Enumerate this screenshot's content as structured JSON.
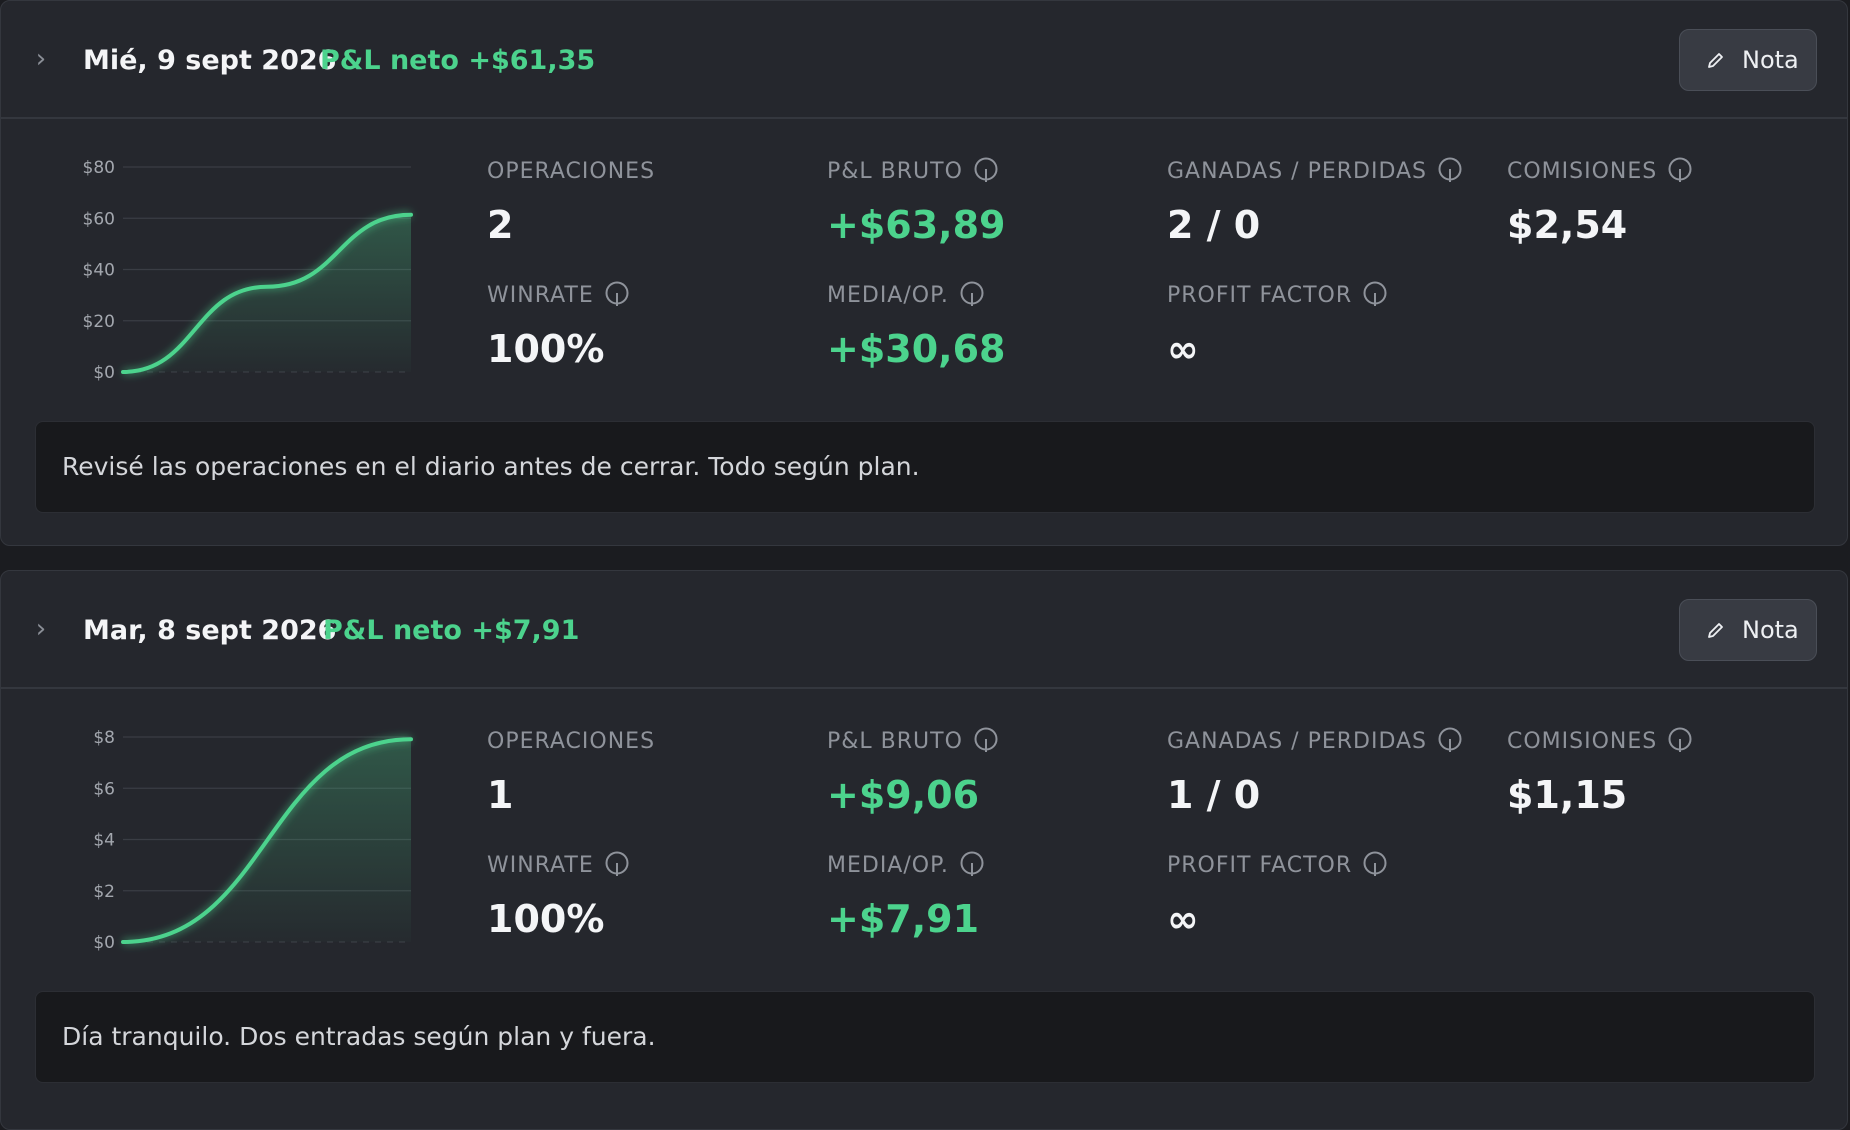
{
  "accent_color": "#4cd38d",
  "days": [
    {
      "date": "Mié, 9 sept 2026",
      "pnl_net_label": "P&L neto",
      "pnl_net_value": "+$61,35",
      "note_button_label": "Nota",
      "chart_data": {
        "type": "area",
        "y_ticks": [
          "$80",
          "$60",
          "$40",
          "$20",
          "$0"
        ],
        "ylim": [
          0,
          80
        ],
        "x": [
          0,
          1,
          2
        ],
        "values": [
          0,
          33.27,
          61.35
        ]
      },
      "metrics": {
        "operaciones": {
          "label": "OPERACIONES",
          "value": "2"
        },
        "pnl_bruto": {
          "label": "P&L BRUTO",
          "value": "+$63,89"
        },
        "ganadas_perdidas": {
          "label": "GANADAS / PERDIDAS",
          "value": "2 / 0"
        },
        "comisiones": {
          "label": "COMISIONES",
          "value": "$2,54"
        },
        "winrate": {
          "label": "WINRATE",
          "value": "100%"
        },
        "media_op": {
          "label": "MEDIA/OP.",
          "value": "+$30,68"
        },
        "profit_factor": {
          "label": "PROFIT FACTOR",
          "value": "∞"
        }
      },
      "note": "Revisé las operaciones en el diario antes de cerrar. Todo según plan."
    },
    {
      "date": "Mar, 8 sept 2026",
      "pnl_net_label": "P&L neto",
      "pnl_net_value": "+$7,91",
      "note_button_label": "Nota",
      "chart_data": {
        "type": "area",
        "y_ticks": [
          "$8",
          "$6",
          "$4",
          "$2",
          "$0"
        ],
        "ylim": [
          0,
          8
        ],
        "x": [
          0,
          1
        ],
        "values": [
          0,
          7.91
        ]
      },
      "metrics": {
        "operaciones": {
          "label": "OPERACIONES",
          "value": "1"
        },
        "pnl_bruto": {
          "label": "P&L BRUTO",
          "value": "+$9,06"
        },
        "ganadas_perdidas": {
          "label": "GANADAS / PERDIDAS",
          "value": "1 / 0"
        },
        "comisiones": {
          "label": "COMISIONES",
          "value": "$1,15"
        },
        "winrate": {
          "label": "WINRATE",
          "value": "100%"
        },
        "media_op": {
          "label": "MEDIA/OP.",
          "value": "+$7,91"
        },
        "profit_factor": {
          "label": "PROFIT FACTOR",
          "value": "∞"
        }
      },
      "note": "Día tranquilo. Dos entradas según plan y fuera."
    }
  ]
}
